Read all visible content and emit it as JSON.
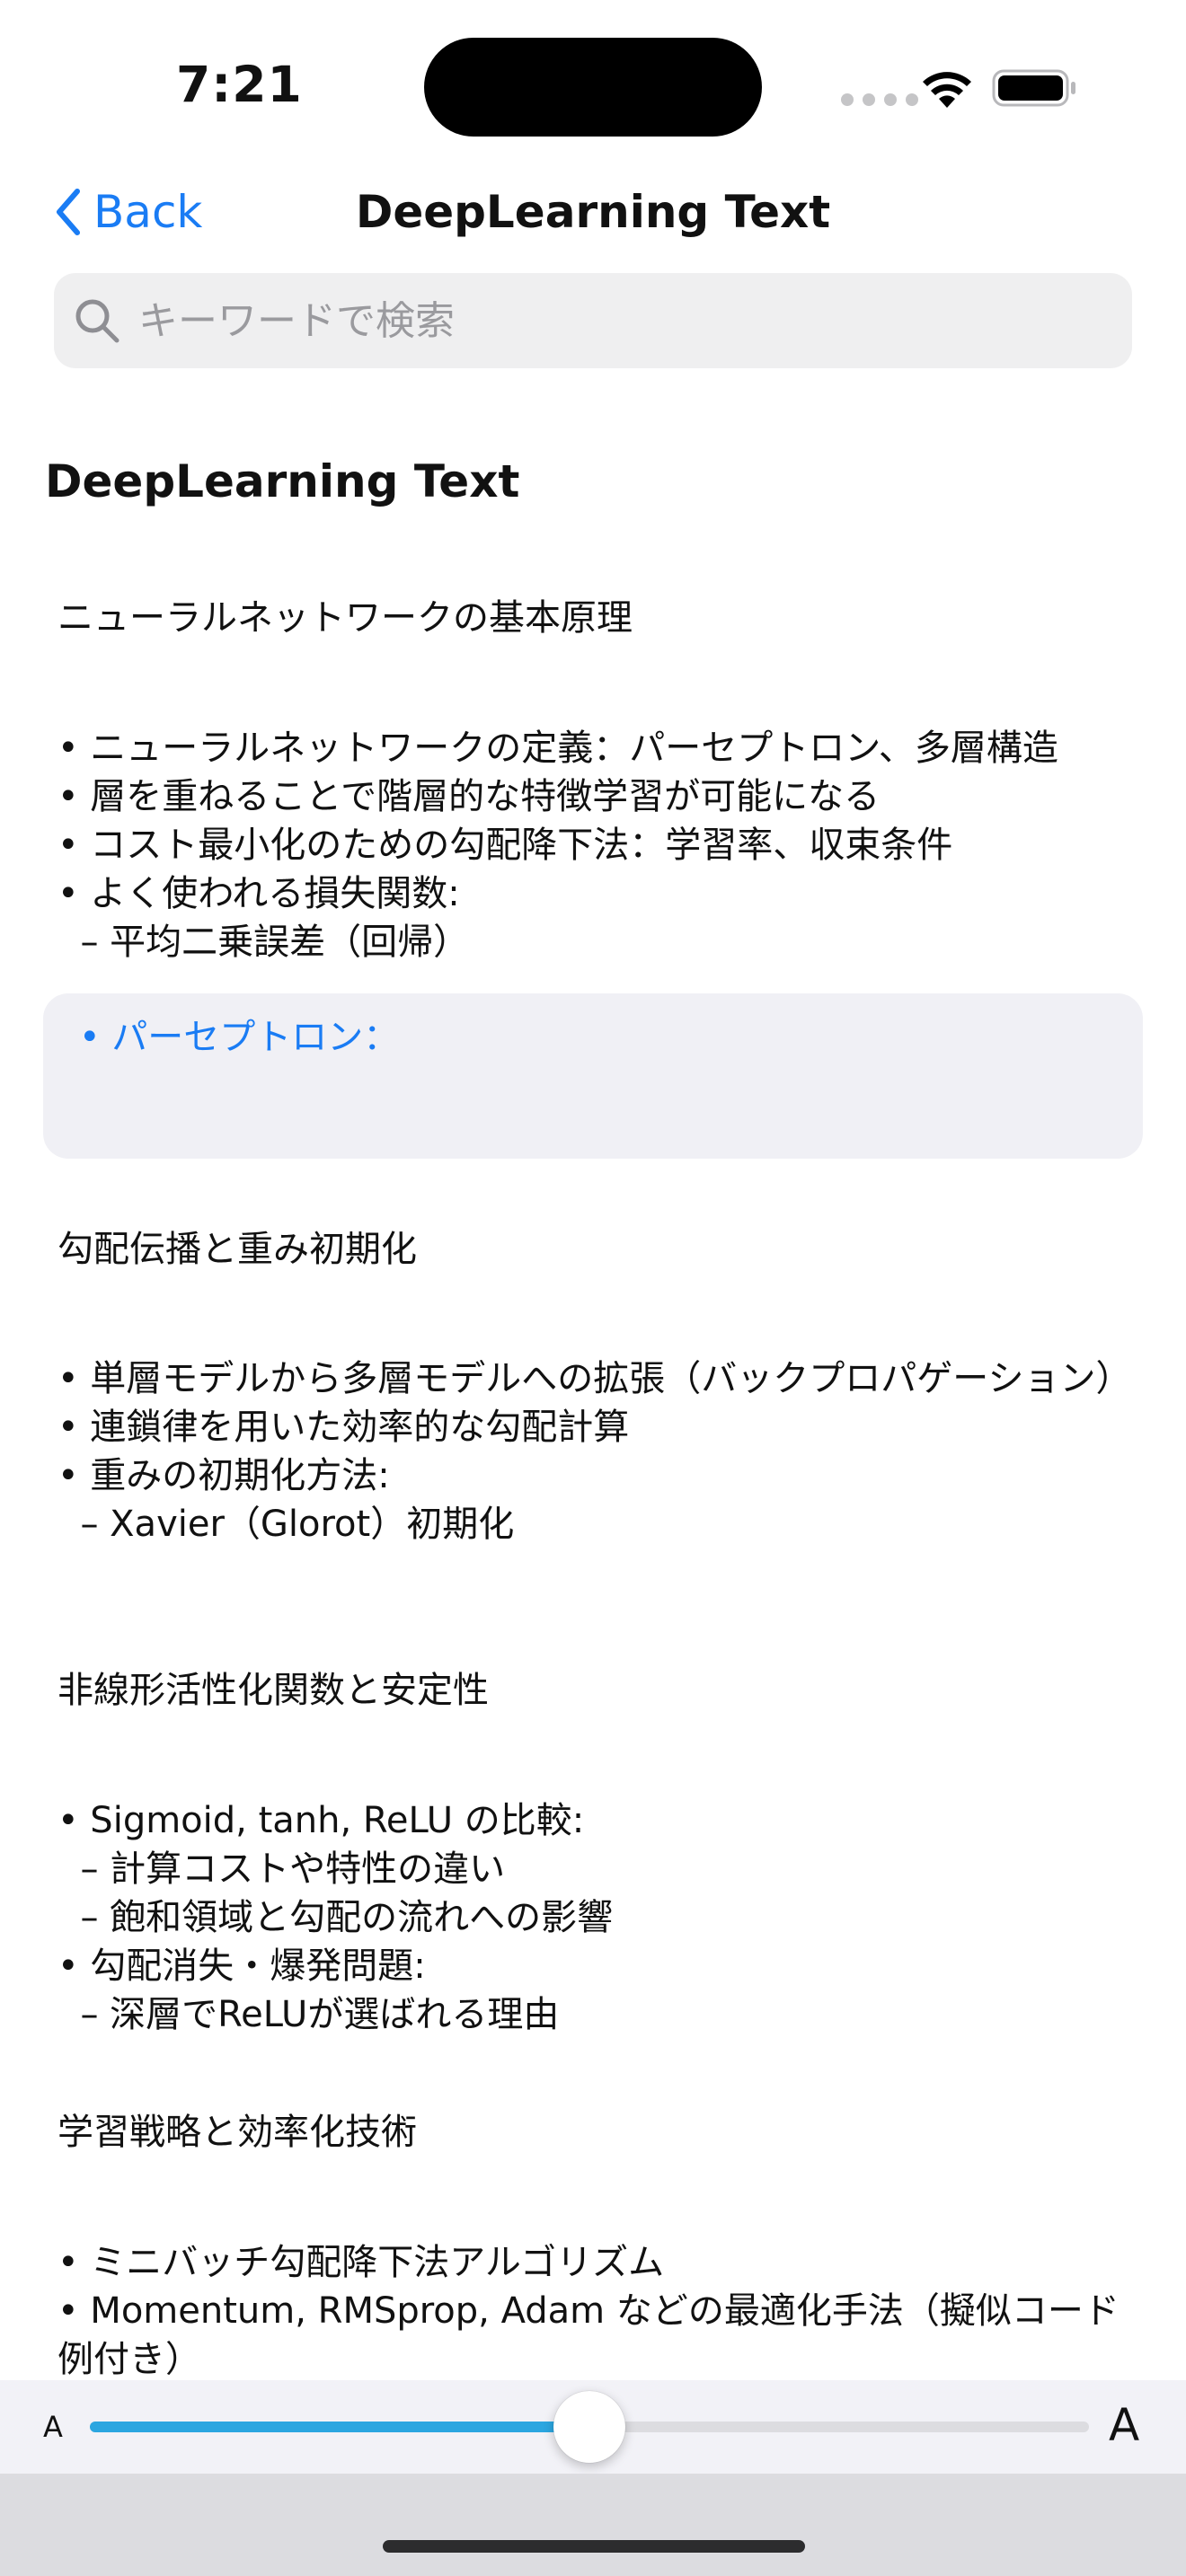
{
  "status_bar": {
    "time": "7:21"
  },
  "nav": {
    "back_label": "Back",
    "title": "DeepLearning Text"
  },
  "search": {
    "placeholder": "キーワードで検索",
    "value": ""
  },
  "content": {
    "doc_title": "DeepLearning Text",
    "sections": [
      {
        "heading": "ニューラルネットワークの基本原理",
        "body": "• ニューラルネットワークの定義：パーセプトロン、多層構造\n• 層を重ねることで階層的な特徴学習が可能になる\n• コスト最小化のための勾配降下法：学習率、収束条件\n• よく使われる損失関数:\n  – 平均二乗誤差（回帰）"
      },
      {
        "heading": "勾配伝播と重み初期化",
        "body": "• 単層モデルから多層モデルへの拡張（バックプロパゲーション）\n• 連鎖律を用いた効率的な勾配計算\n• 重みの初期化方法:\n  – Xavier（Glorot）初期化"
      },
      {
        "heading": "非線形活性化関数と安定性",
        "body": "• Sigmoid, tanh, ReLU の比較:\n  – 計算コストや特性の違い\n  – 飽和領域と勾配の流れへの影響\n• 勾配消失・爆発問題:\n  – 深層でReLUが選ばれる理由"
      },
      {
        "heading": "学習戦略と効率化技術",
        "body": "• ミニバッチ勾配降下法アルゴリズム\n• Momentum, RMSprop, Adam などの最適化手法（擬似コード例付き）"
      }
    ],
    "highlight": {
      "text": "• パーセプトロン："
    }
  },
  "font_slider": {
    "small_label": "A",
    "large_label": "A",
    "value_fraction": 0.5
  },
  "colors": {
    "accent": "#1a7cf4",
    "slider_fill": "#2ba6e0",
    "card_background": "#f0f0f5"
  }
}
